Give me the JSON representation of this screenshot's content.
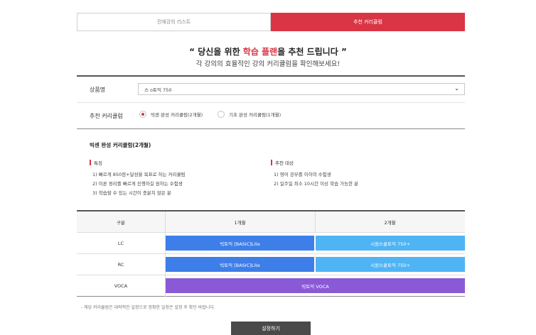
{
  "tabs": [
    {
      "label": "전체강의 리스트",
      "active": false
    },
    {
      "label": "추천 커리큘럼",
      "active": true
    }
  ],
  "headline": {
    "quote_open": "“",
    "part1": " 당신을 위한 ",
    "highlight": "학습 플랜",
    "part2": "을 추천 드립니다 ",
    "quote_close": "”"
  },
  "subline": "각 강의의 효율적인 강의 커리큘럼을 확인해보세요!",
  "product": {
    "label": "상품명",
    "selected": "스 o토익 750",
    "chevron": "⌄"
  },
  "curriculum": {
    "label": "추천 커리큘럼",
    "options": [
      {
        "label": "빅센 완성 커리큘럼(2개월)",
        "selected": true
      },
      {
        "label": "기초 완성 커리큘럼(1개월)",
        "selected": false
      }
    ]
  },
  "detail": {
    "title": "빅센 완성 커리큘럼(2개월)",
    "features_title": "특징",
    "features": [
      "1) 빠르게 850점+달성을 목표로 하는 커리큘럼",
      "2) 이론 정리를 빠르게 진행하길 원하는 수험생",
      "3) 학습할 수 있는 시간이 충분치 않은 분"
    ],
    "target_title": "추천 대상",
    "targets": [
      "1) 영어 공부를 이하의 수험생",
      "2) 일주일 최소 10시간 이상 학습 가능한 분"
    ]
  },
  "table": {
    "headers": [
      "구분",
      "1개월",
      "2개월"
    ],
    "rows": [
      {
        "label": "LC",
        "m1": "빅토익 [BASIC]Lite",
        "m2": "시원스쿨토익 750+"
      },
      {
        "label": "RC",
        "m1": "빅토익 [BASIC]Lite",
        "m2": "시원스쿨토익 750+"
      },
      {
        "label": "VOCA",
        "span": "빅토익 VOCA"
      }
    ]
  },
  "note": "- 해당 커리큘럼은 대략적인 일정으로 정확한 일정은 설정 후 확인 바랍니다.",
  "apply_label": "설정하기",
  "colors": {
    "accent": "#d93544",
    "blue": "#3d7ee9",
    "sky": "#4fb4f4",
    "purple": "#8a5ad6",
    "button": "#4a4a4a"
  }
}
